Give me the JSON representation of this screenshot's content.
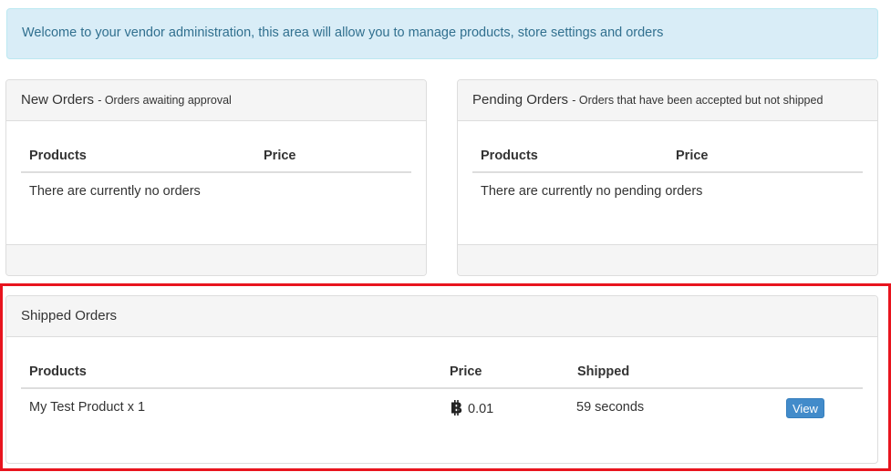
{
  "welcome_alert": {
    "text": "Welcome to your vendor administration, this area will allow you to manage products, store settings and orders"
  },
  "new_orders": {
    "title": "New Orders",
    "subtitle": "- Orders awaiting approval",
    "columns": [
      "Products",
      "Price"
    ],
    "empty_message": "There are currently no orders"
  },
  "pending_orders": {
    "title": "Pending Orders",
    "subtitle": "- Orders that have been accepted but not shipped",
    "columns": [
      "Products",
      "Price"
    ],
    "empty_message": "There are currently no pending orders"
  },
  "shipped_orders": {
    "title": "Shipped Orders",
    "columns": [
      "Products",
      "Price",
      "Shipped"
    ],
    "rows": [
      {
        "product": "My Test Product x 1",
        "price_icon": "bitcoin-icon",
        "price": "0.01",
        "shipped": "59 seconds",
        "action_label": "View"
      }
    ]
  },
  "colors": {
    "alert_bg": "#d9edf7",
    "alert_text": "#31708f",
    "button": "#428bca",
    "highlight": "#e8141e"
  }
}
